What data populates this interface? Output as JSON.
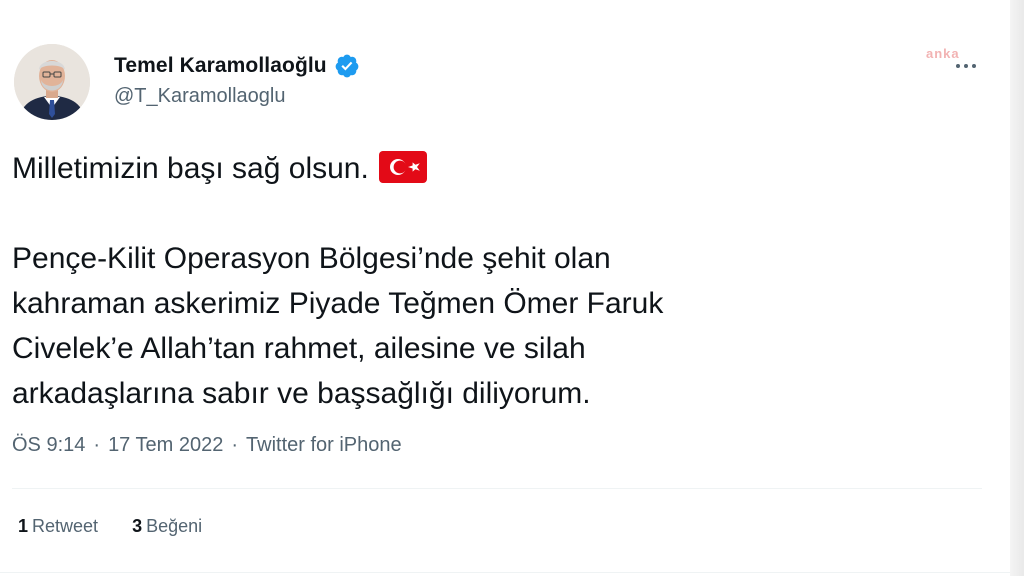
{
  "author": {
    "display_name": "Temel Karamollaoğlu",
    "handle": "@T_Karamollaoglu",
    "verified": true,
    "avatar_icon": "profile-photo"
  },
  "watermark": "anka",
  "tweet": {
    "paragraph1": "Milletimizin başı sağ olsun.",
    "flag_emoji": "turkey-flag",
    "paragraph2_lines": [
      "Pençe-Kilit Operasyon Bölgesi’nde şehit olan",
      "kahraman askerimiz Piyade Teğmen Ömer Faruk",
      "Civelek’e Allah’tan rahmet, ailesine ve silah",
      "arkadaşlarına sabır ve başsağlığı diliyorum."
    ]
  },
  "meta": {
    "time": "ÖS 9:14",
    "separator": "·",
    "date": "17 Tem 2022",
    "source": "Twitter for iPhone"
  },
  "stats": {
    "retweets_count": "1",
    "retweets_label": "Retweet",
    "likes_count": "3",
    "likes_label": "Beğeni"
  },
  "colors": {
    "text": "#0f1419",
    "secondary": "#536471",
    "verified": "#1d9bf0",
    "flag_red": "#e30a17",
    "divider": "#eff3f4"
  }
}
